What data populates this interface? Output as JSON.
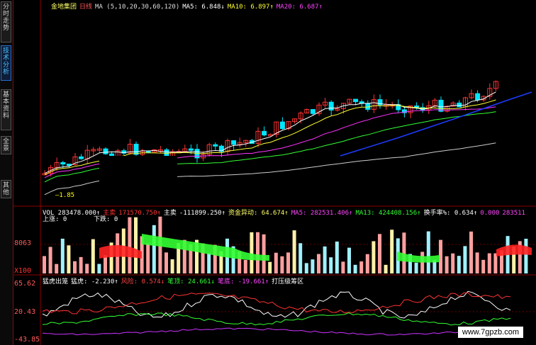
{
  "colors": {
    "up": "#ff3333",
    "down": "#00e5ff",
    "ma5": "#ffffff",
    "ma10": "#ffff33",
    "ma20": "#ff33ff",
    "ma30": "#33ff33",
    "ma60": "#cccccc",
    "ma120": "#1e3cff",
    "grid": "#8b0000",
    "green_band": "#33ff33",
    "red_band": "#ff2222"
  },
  "sidebar": {
    "tabs": [
      {
        "label": "分时走势",
        "active": false
      },
      {
        "label": "技术分析",
        "active": true
      },
      {
        "label": "基本资料",
        "active": false
      },
      {
        "label": "全景",
        "active": false
      },
      {
        "label": "其他",
        "active": false
      }
    ]
  },
  "price_header": {
    "stock": "金地集团",
    "period": "日线",
    "ma_spec": "MA (5,10,20,30,60,120)",
    "ma5": "MA5: 6.848↓",
    "ma10": "MA10: 6.897↑",
    "ma20": "MA20: 6.687↑"
  },
  "price_chart": {
    "low_label": "—1.85"
  },
  "volume_header": {
    "vol": "VOL 283478.000↑",
    "main_sell": "主卖",
    "main_sell_value": "171570.750↑",
    "main_buy_label": "主卖",
    "main_buy_value": "-111899.250↑",
    "fund_move": "资金异动: 64.674↑",
    "ma5": "MA5: 282531.406↑",
    "ma13": "MA13: 424408.156↑",
    "turnover": "换手率%: 0.634↑",
    "zero": "0.000",
    "extra": "283511"
  },
  "volume_sub": {
    "up_label": "上涨: 0",
    "down_label": "下跌: 0"
  },
  "volume_axis": {
    "mid": "8063",
    "low": "X100"
  },
  "osc_header": {
    "name": "猛虎出笼",
    "tiger": "猛虎: -2.230↑",
    "fengwu": "风险: 0.574↓",
    "bi": "笔顶: 24.661↓",
    "bidi": "笔底: -19.661↑",
    "sell": "打压级筹区"
  },
  "osc_axis": {
    "top": "65.62",
    "mid": "20.43",
    "bottom": "-43.85"
  },
  "watermark": "www.7gpzb.com"
}
